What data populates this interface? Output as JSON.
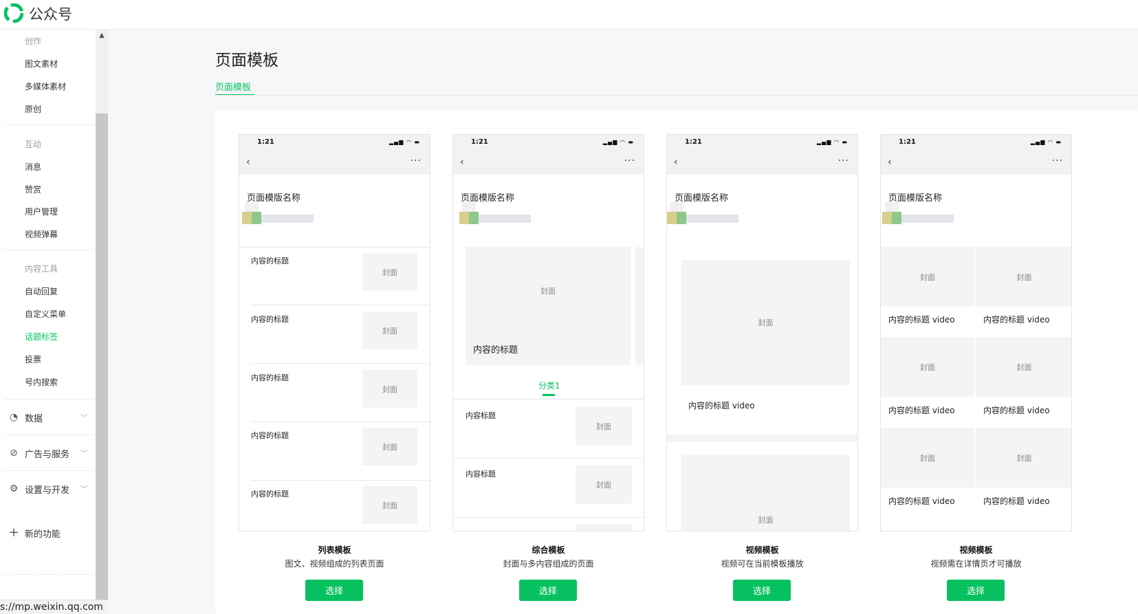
{
  "header": {
    "app_title": "公众号"
  },
  "sidebar": {
    "groups": [
      {
        "label": "创作",
        "items": [
          "图文素材",
          "多媒体素材",
          "原创"
        ]
      },
      {
        "label": "互动",
        "items": [
          "消息",
          "赞赏",
          "用户管理",
          "视频弹幕"
        ]
      },
      {
        "label": "内容工具",
        "items": [
          "自动回复",
          "自定义菜单",
          "话题标签",
          "投票",
          "号内搜索"
        ]
      }
    ],
    "major": [
      "数据",
      "广告与服务",
      "设置与开发"
    ],
    "new_feature": "新的功能",
    "active_item": "话题标签"
  },
  "status_url": "s://mp.weixin.qq.com",
  "page": {
    "title": "页面模板",
    "tab": "页面模板"
  },
  "phone": {
    "time": "1:21",
    "template_name": "页面模版名称"
  },
  "templates": [
    {
      "caption": "列表模板",
      "desc": "图文、视频组成的列表页面",
      "button": "选择",
      "rows": [
        "内容的标题",
        "内容的标题",
        "内容的标题",
        "内容的标题",
        "内容的标题"
      ],
      "cover": "封面"
    },
    {
      "caption": "综合模板",
      "desc": "封面与多内容组成的页面",
      "button": "选择",
      "hero_cover": "封面",
      "hero_title": "内容的标题",
      "category": "分类1",
      "rows": [
        "内容标题",
        "内容标题"
      ],
      "cover": "封面"
    },
    {
      "caption": "视频模板",
      "desc": "视频可在当前模板播放",
      "button": "选择",
      "cover": "封面",
      "video_title": "内容的标题 video"
    },
    {
      "caption": "视频模板",
      "desc": "视频需在详情页才可播放",
      "button": "选择",
      "cover": "封面",
      "video_title": "内容的标题 video"
    }
  ]
}
